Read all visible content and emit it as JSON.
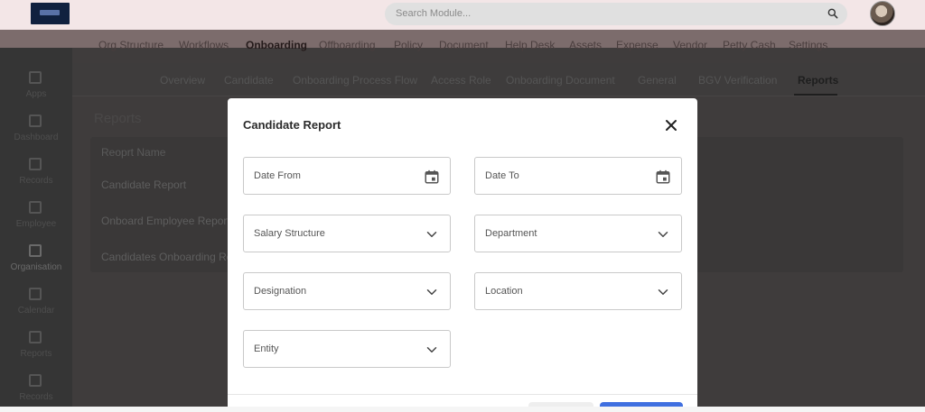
{
  "header": {
    "search_placeholder": "Search Module..."
  },
  "main_nav": [
    {
      "label": "Org Structure"
    },
    {
      "label": "Workflows"
    },
    {
      "label": "Onboarding",
      "active": true
    },
    {
      "label": "Offboarding"
    },
    {
      "label": "Policy"
    },
    {
      "label": "Document"
    },
    {
      "label": "Help Desk"
    },
    {
      "label": "Assets"
    },
    {
      "label": "Expense"
    },
    {
      "label": "Vendor"
    },
    {
      "label": "Petty Cash"
    },
    {
      "label": "Settings"
    }
  ],
  "sidebar": [
    {
      "label": "Apps",
      "icon": "grid-icon"
    },
    {
      "label": "Dashboard",
      "icon": "dashboard-icon"
    },
    {
      "label": "Records",
      "icon": "records-icon"
    },
    {
      "label": "Employee",
      "icon": "people-icon"
    },
    {
      "label": "Organisation",
      "icon": "building-icon",
      "active": true
    },
    {
      "label": "Calendar",
      "icon": "calendar-icon"
    },
    {
      "label": "Reports",
      "icon": "chart-icon"
    },
    {
      "label": "Records",
      "icon": "document-icon"
    }
  ],
  "sub_nav": [
    {
      "label": "Overview"
    },
    {
      "label": "Candidate"
    },
    {
      "label": "Onboarding Process Flow"
    },
    {
      "label": "Access Role"
    },
    {
      "label": "Onboarding Document"
    },
    {
      "label": "General"
    },
    {
      "label": "BGV Verification"
    },
    {
      "label": "Reports",
      "active": true
    }
  ],
  "reports_page": {
    "title": "Reports",
    "column_header": "Reoprt Name",
    "rows": [
      "Candidate Report",
      "Onboard Employee Reports",
      "Candidates Onboarding Rep"
    ]
  },
  "modal": {
    "title": "Candidate Report",
    "fields": {
      "date_from": "Date From",
      "date_to": "Date To",
      "salary_structure": "Salary Structure",
      "department": "Department",
      "designation": "Designation",
      "location": "Location",
      "entity": "Entity"
    }
  }
}
